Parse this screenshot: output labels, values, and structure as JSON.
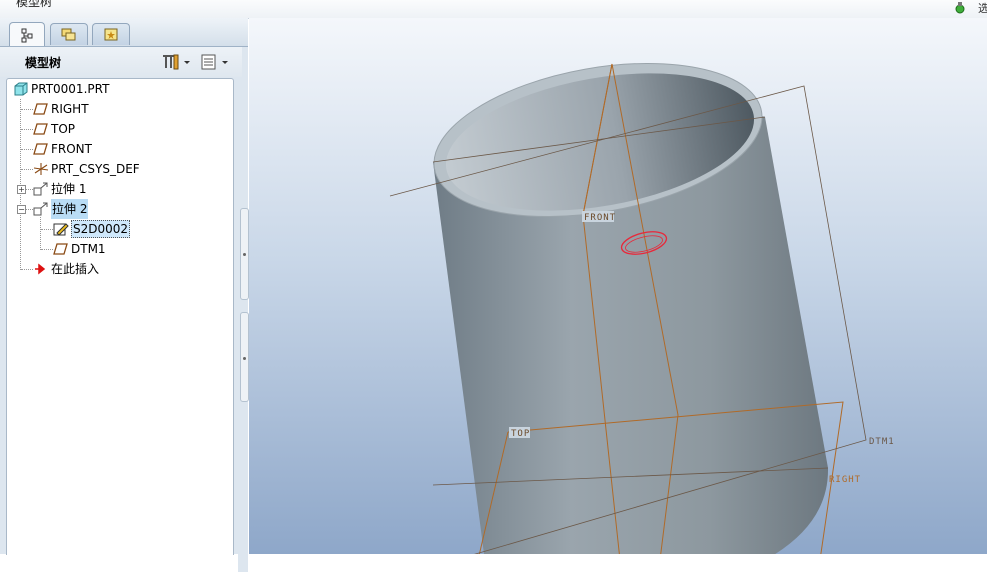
{
  "window": {
    "title": "模型树"
  },
  "topbar": {
    "right_text": "选"
  },
  "tabs": [
    {
      "name": "model-tree",
      "icon": "model-tree-icon"
    },
    {
      "name": "folder-browser",
      "icon": "folder-icon"
    },
    {
      "name": "favorites",
      "icon": "star-icon"
    }
  ],
  "panel": {
    "header": "模型树"
  },
  "tree": {
    "root": "PRT0001.PRT",
    "items": [
      {
        "label": "RIGHT",
        "icon": "datum-plane-icon"
      },
      {
        "label": "TOP",
        "icon": "datum-plane-icon"
      },
      {
        "label": "FRONT",
        "icon": "datum-plane-icon"
      },
      {
        "label": "PRT_CSYS_DEF",
        "icon": "coordinate-system-icon"
      },
      {
        "label": "拉伸 1",
        "icon": "extrude-icon"
      },
      {
        "label": "拉伸 2",
        "icon": "extrude-icon"
      },
      {
        "label": "S2D0002",
        "icon": "sketch-icon"
      },
      {
        "label": "DTM1",
        "icon": "datum-plane-icon"
      },
      {
        "label": "在此插入",
        "icon": "insert-here-arrow-icon"
      }
    ]
  },
  "viewport": {
    "labels": {
      "front": "FRONT",
      "top": "TOP",
      "right": "RIGHT",
      "dtm1": "DTM1"
    },
    "colors": {
      "datum": "#b06a28",
      "model": "#8c979f",
      "sketch": "#e8283a"
    }
  }
}
